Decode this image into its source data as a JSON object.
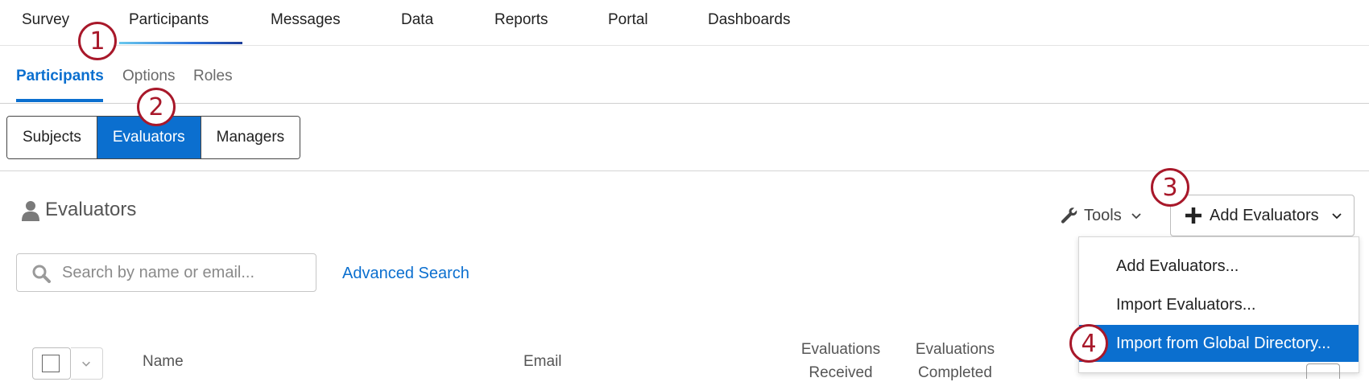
{
  "topnav": {
    "items": [
      "Survey",
      "Participants",
      "Messages",
      "Data",
      "Reports",
      "Portal",
      "Dashboards"
    ],
    "active": "Participants"
  },
  "subnav": {
    "items": [
      "Participants",
      "Options",
      "Roles"
    ],
    "active": "Participants"
  },
  "segments": {
    "items": [
      "Subjects",
      "Evaluators",
      "Managers"
    ],
    "active": "Evaluators"
  },
  "section": {
    "title": "Evaluators",
    "icon": "person-icon"
  },
  "toolbar": {
    "tools_label": "Tools",
    "add_label": "Add Evaluators"
  },
  "search": {
    "placeholder": "Search by name or email...",
    "value": "",
    "advanced_label": "Advanced Search"
  },
  "menu": {
    "items": [
      "Add Evaluators...",
      "Import Evaluators...",
      "Import from Global Directory..."
    ],
    "selected": "Import from Global Directory..."
  },
  "table": {
    "columns": [
      "Name",
      "Email",
      "Evaluations Received",
      "Evaluations Completed"
    ],
    "col_lines": {
      "received": [
        "Evaluations",
        "Received"
      ],
      "completed": [
        "Evaluations",
        "Completed"
      ]
    }
  },
  "callouts": [
    "1",
    "2",
    "3",
    "4"
  ],
  "colors": {
    "accent": "#0b6fcf",
    "callout": "#a8182a"
  }
}
